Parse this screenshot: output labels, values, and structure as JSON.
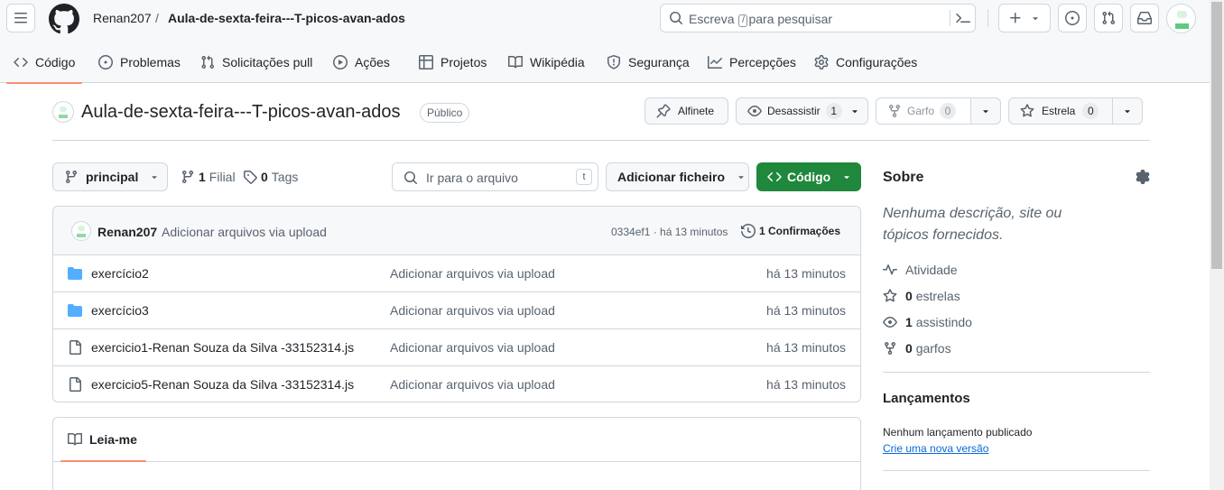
{
  "header": {
    "owner": "Renan207",
    "separator": "/",
    "repo": "Aula-de-sexta-feira---T-picos-avan-ados",
    "search_placeholder_pre": "Escreva",
    "search_key": "/",
    "search_placeholder_post": "para pesquisar"
  },
  "tabs": [
    {
      "label": "Código"
    },
    {
      "label": "Problemas"
    },
    {
      "label": "Solicitações pull"
    },
    {
      "label": "Ações"
    },
    {
      "label": "Projetos"
    },
    {
      "label": "Wikipédia"
    },
    {
      "label": "Segurança"
    },
    {
      "label": "Percepções"
    },
    {
      "label": "Configurações"
    }
  ],
  "repo": {
    "name": "Aula-de-sexta-feira---T-picos-avan-ados",
    "visibility": "Público",
    "pin_label": "Alfinete",
    "watch_label": "Desassistir",
    "watch_count": "1",
    "fork_label": "Garfo",
    "fork_count": "0",
    "star_label": "Estrela",
    "star_count": "0"
  },
  "browser": {
    "branch": "principal",
    "branches_count": "1",
    "branches_label": "Filial",
    "tags_count": "0",
    "tags_label": "Tags",
    "goto_placeholder": "Ir para o arquivo",
    "goto_key": "t",
    "add_file_label": "Adicionar ficheiro",
    "code_label": "Código"
  },
  "commit": {
    "author": "Renan207",
    "message": "Adicionar arquivos via upload",
    "meta": "0334ef1 · há 13 minutos",
    "commits_label": "1 Confirmações"
  },
  "files": [
    {
      "name": "exercício2",
      "type": "folder",
      "message": "Adicionar arquivos via upload",
      "time": "há 13 minutos"
    },
    {
      "name": "exercício3",
      "type": "folder",
      "message": "Adicionar arquivos via upload",
      "time": "há 13 minutos"
    },
    {
      "name": "exercicio1-Renan Souza da Silva -33152314.js",
      "type": "file",
      "message": "Adicionar arquivos via upload",
      "time": "há 13 minutos"
    },
    {
      "name": "exercicio5-Renan Souza da Silva -33152314.js",
      "type": "file",
      "message": "Adicionar arquivos via upload",
      "time": "há 13 minutos"
    }
  ],
  "readme": {
    "tab_label": "Leia-me"
  },
  "about": {
    "title": "Sobre",
    "description": "Nenhuma descrição, site ou tópicos fornecidos.",
    "activity": "Atividade",
    "stars_count": "0",
    "stars_label": "estrelas",
    "watching_count": "1",
    "watching_label": "assistindo",
    "forks_count": "0",
    "forks_label": "garfos"
  },
  "releases": {
    "title": "Lançamentos",
    "empty": "Nenhum lançamento publicado",
    "create_link": "Crie uma nova versão"
  },
  "colors": {
    "accent_green": "#1f883d",
    "tab_underline": "#fd8c73",
    "link": "#0969da"
  }
}
